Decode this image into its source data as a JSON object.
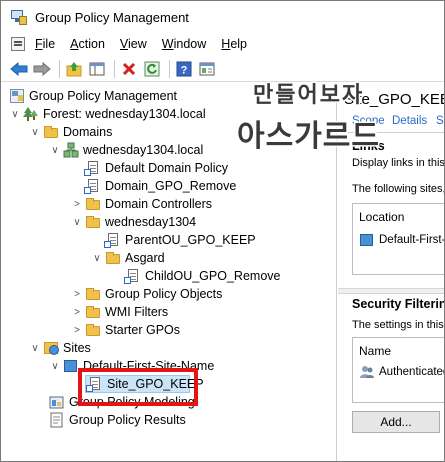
{
  "window": {
    "title": "Group Policy Management"
  },
  "menu": {
    "items": [
      {
        "label": "File",
        "accel": "F",
        "rest": "ile"
      },
      {
        "label": "Action",
        "accel": "A",
        "rest": "ction"
      },
      {
        "label": "View",
        "accel": "V",
        "rest": "iew"
      },
      {
        "label": "Window",
        "accel": "W",
        "rest": "indow"
      },
      {
        "label": "Help",
        "accel": "H",
        "rest": "elp"
      }
    ]
  },
  "toolbar": {
    "buttons": [
      "back-icon",
      "forward-icon",
      "up-folder-icon",
      "show-hide-tree-icon",
      "delete-icon",
      "refresh-icon",
      "help-icon",
      "properties-icon"
    ]
  },
  "tree": {
    "root": "Group Policy Management",
    "forest": "Forest: wednesday1304.local",
    "domains": "Domains",
    "domain": "wednesday1304.local",
    "default_domain_policy": "Default Domain Policy",
    "domain_gpo_remove": "Domain_GPO_Remove",
    "domain_controllers": "Domain Controllers",
    "ou": "wednesday1304",
    "parent_ou_gpo": "ParentOU_GPO_KEEP",
    "asgard": "Asgard",
    "child_ou_gpo": "ChildOU_GPO_Remove",
    "group_policy_objects": "Group Policy Objects",
    "wmi_filters": "WMI Filters",
    "starter_gpos": "Starter GPOs",
    "sites": "Sites",
    "default_site": "Default-First-Site-Name",
    "site_gpo": "Site_GPO_KEEP",
    "modeling": "Group Policy Modeling",
    "results": "Group Policy Results"
  },
  "details": {
    "title": "Site_GPO_KEEP",
    "tabs": [
      "Scope",
      "Details",
      "Se"
    ],
    "links_heading": "Links",
    "links_text": "Display links in this lo",
    "links_desc": "The following sites, d",
    "location_header": "Location",
    "location_value": "Default-First-Sit",
    "security_heading": "Security Filtering",
    "security_text": "The settings in this G",
    "name_header": "Name",
    "name_value": "Authenticated",
    "add_button": "Add..."
  },
  "watermark": {
    "line1": "만들어보자",
    "line2": "아스가르드"
  },
  "colors": {
    "selection": "#cce4f7",
    "highlight_box": "#e21414",
    "link": "#2a6bc7"
  }
}
